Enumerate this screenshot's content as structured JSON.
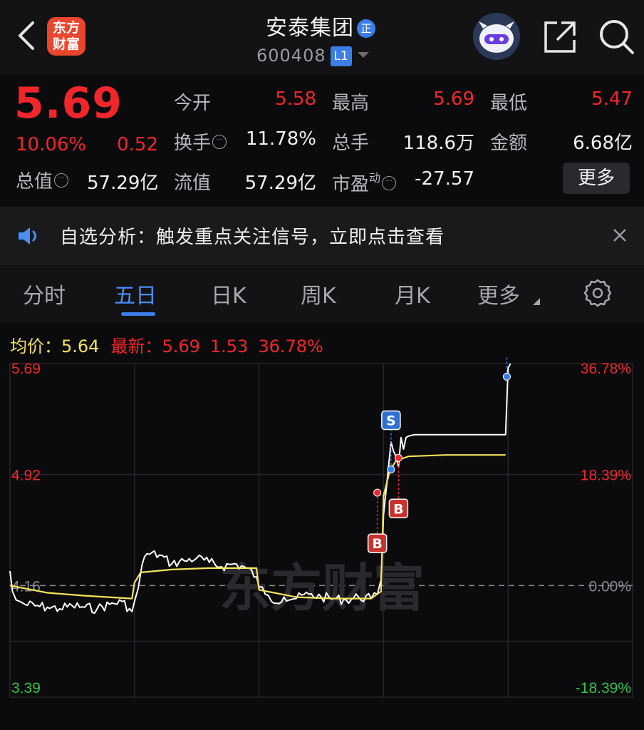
{
  "header": {
    "logo_text_line1": "东方",
    "logo_text_line2": "财富",
    "stock_name": "安泰集团",
    "name_badge": "正",
    "stock_code": "600408",
    "level_badge": "L1"
  },
  "quote": {
    "price": "5.69",
    "change_pct": "10.06%",
    "change_amt": "0.52",
    "total_value_label": "总值",
    "total_value": "57.29亿",
    "fields": {
      "open_label": "今开",
      "open": "5.58",
      "high_label": "最高",
      "high": "5.69",
      "low_label": "最低",
      "low": "5.47",
      "turnover_label": "换手",
      "turnover": "11.78%",
      "volume_label": "总手",
      "volume": "118.6万",
      "amount_label": "金额",
      "amount": "6.68亿",
      "float_label": "流值",
      "float_value": "57.29亿",
      "pe_label": "市盈",
      "pe_sup": "动",
      "pe": "-27.57"
    },
    "more_label": "更多"
  },
  "notice": {
    "text": "自选分析：触发重点关注信号，立即点击查看"
  },
  "tabs": [
    {
      "label": "分时",
      "active": false
    },
    {
      "label": "五日",
      "active": true
    },
    {
      "label": "日K",
      "active": false
    },
    {
      "label": "周K",
      "active": false
    },
    {
      "label": "月K",
      "active": false
    },
    {
      "label": "更多",
      "active": false
    }
  ],
  "chart_header": {
    "avg_label": "均价：",
    "avg_value": "5.64",
    "latest_label": "最新：",
    "latest_price": "5.69",
    "latest_change": "1.53",
    "latest_pct": "36.78%"
  },
  "colors": {
    "up": "#f0262c",
    "down": "#2ec44a",
    "avg_line": "#f2e35a",
    "price_line": "#ffffff",
    "accent": "#3b7ee8"
  },
  "chart_data": {
    "type": "line",
    "title": "",
    "days": 5,
    "ylim": [
      3.39,
      5.69
    ],
    "prev_close": 4.16,
    "y_left_ticks": [
      "5.69",
      "4.92",
      "4.16",
      "3.39"
    ],
    "y_right_ticks": [
      "36.78%",
      "18.39%",
      "0.00%",
      "-18.39%"
    ],
    "watermark": "东方财富",
    "series": [
      {
        "name": "price",
        "x": [
          0,
          0.02,
          0.05,
          0.08,
          0.12,
          0.2,
          0.3,
          0.4,
          0.5,
          0.6,
          0.7,
          0.8,
          0.9,
          0.98,
          1.0,
          1.03,
          1.06,
          1.1,
          1.2,
          1.3,
          1.4,
          1.5,
          1.6,
          1.7,
          1.8,
          1.9,
          1.98,
          2.0,
          2.05,
          2.1,
          2.2,
          2.3,
          2.4,
          2.5,
          2.6,
          2.7,
          2.8,
          2.9,
          2.95,
          2.98,
          3.0,
          3.03,
          3.06,
          3.1,
          3.12,
          3.14,
          3.16,
          3.18,
          3.2,
          3.25,
          3.3,
          3.4,
          3.5,
          3.6,
          3.7,
          3.8,
          3.9,
          3.98,
          4.0,
          4.02
        ],
        "values": [
          4.26,
          4.12,
          4.06,
          4.05,
          4.03,
          4.02,
          4.01,
          4.0,
          4.02,
          4.01,
          4.0,
          4.03,
          4.05,
          3.98,
          4.05,
          4.14,
          4.3,
          4.38,
          4.37,
          4.31,
          4.33,
          4.35,
          4.32,
          4.29,
          4.31,
          4.28,
          4.22,
          4.15,
          4.1,
          4.05,
          4.08,
          4.07,
          4.1,
          4.08,
          4.07,
          4.06,
          4.08,
          4.07,
          4.1,
          4.2,
          4.65,
          4.89,
          5.15,
          5.05,
          4.98,
          5.18,
          5.1,
          5.18,
          5.19,
          5.2,
          5.2,
          5.2,
          5.2,
          5.2,
          5.2,
          5.2,
          5.2,
          5.2,
          5.66,
          5.69
        ]
      },
      {
        "name": "avg",
        "x": [
          0,
          0.3,
          0.6,
          0.98,
          1.0,
          1.05,
          1.3,
          1.6,
          1.98,
          2.0,
          2.3,
          2.6,
          2.9,
          2.98,
          3.0,
          3.05,
          3.1,
          3.2,
          3.5,
          3.98
        ],
        "values": [
          4.16,
          4.11,
          4.09,
          4.07,
          4.18,
          4.25,
          4.27,
          4.28,
          4.28,
          4.13,
          4.08,
          4.07,
          4.07,
          4.12,
          4.78,
          4.95,
          5.02,
          5.05,
          5.06,
          5.06
        ]
      }
    ],
    "markers": [
      {
        "type": "B",
        "x": 2.95,
        "price": 4.8,
        "kind": "buy"
      },
      {
        "type": "B",
        "x": 3.12,
        "price": 5.04,
        "kind": "buy"
      },
      {
        "type": "S",
        "x": 3.06,
        "price": 4.96,
        "kind": "sell"
      },
      {
        "type": "S",
        "x": 3.99,
        "price": 5.6,
        "kind": "sell"
      }
    ]
  }
}
